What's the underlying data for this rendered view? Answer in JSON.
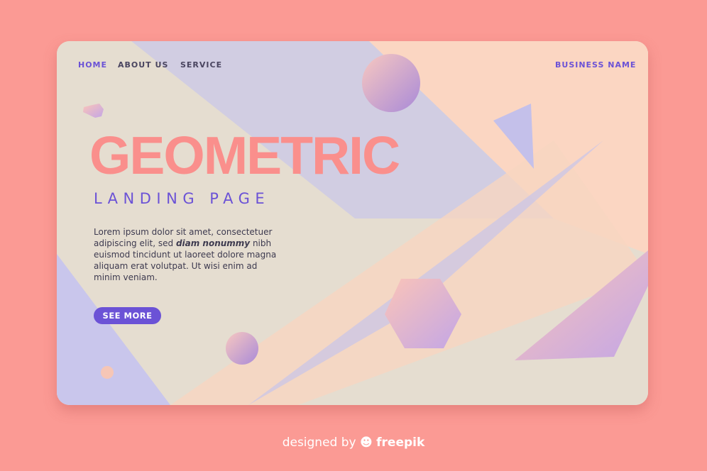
{
  "nav": {
    "items": [
      {
        "label": "HOME",
        "active": true
      },
      {
        "label": "ABOUT US"
      },
      {
        "label": "SERVICE"
      }
    ],
    "brand": "BUSINESS NAME"
  },
  "hero": {
    "title": "GEOMETRIC",
    "subtitle": "LANDING PAGE",
    "body_before": "Lorem ipsum dolor sit amet, consectetuer adipiscing elit, sed ",
    "body_bold": "diam nonummy",
    "body_after": " nibh euismod tincidunt ut laoreet dolore magna aliquam erat volutpat. Ut wisi enim ad minim veniam.",
    "button": "SEE MORE"
  },
  "footer": {
    "prefix": "designed by",
    "brand": "freepik",
    "icon": "freepik-logo-icon"
  },
  "colors": {
    "background": "#fb9a94",
    "accent": "#6b52d6",
    "title": "#fa8f8c"
  }
}
